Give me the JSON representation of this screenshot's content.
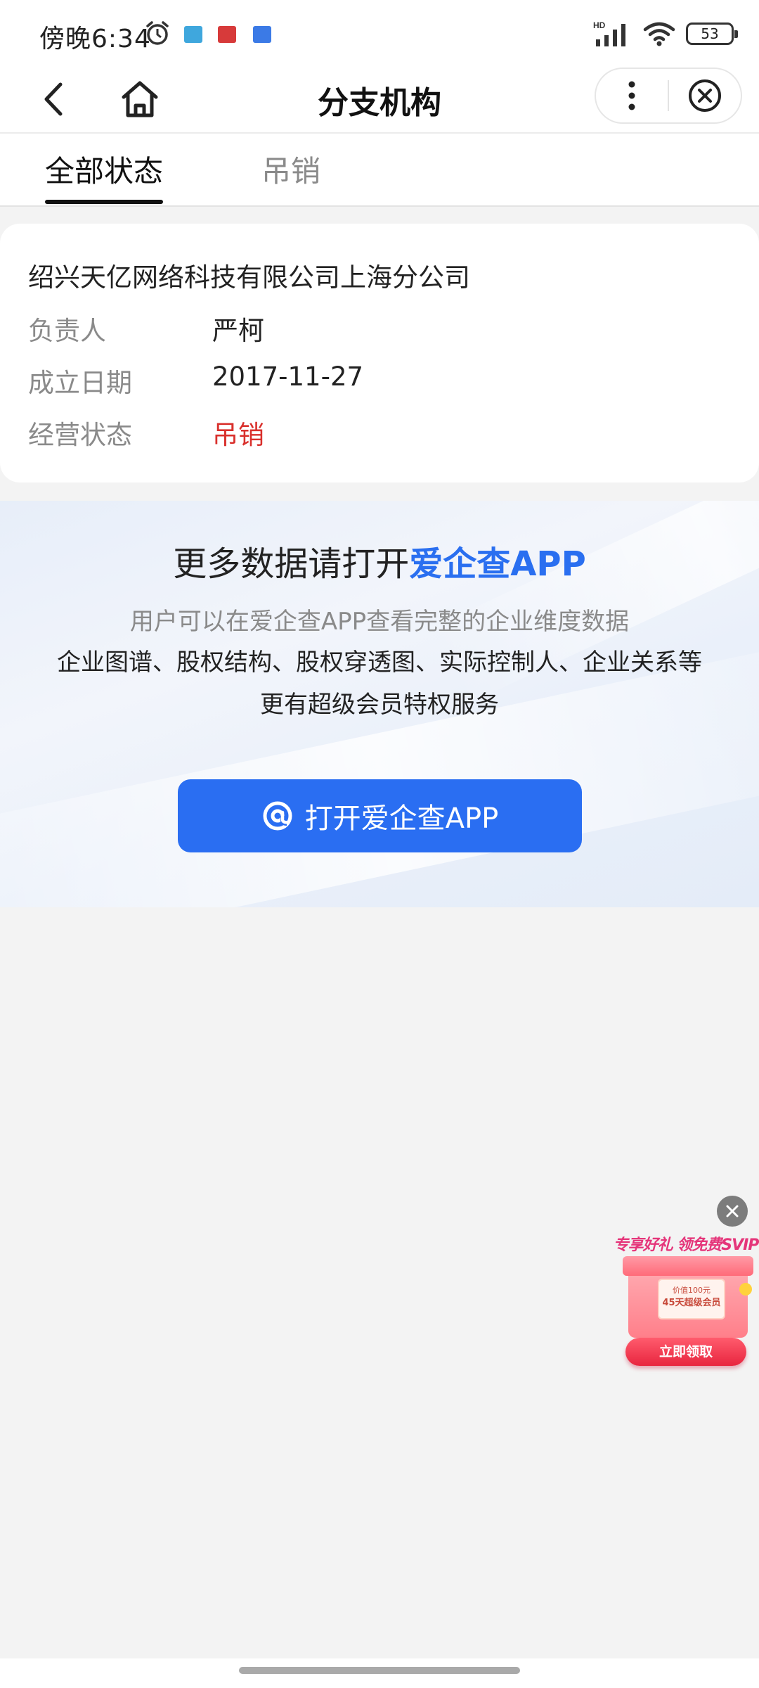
{
  "status_bar": {
    "time": "傍晚6:34",
    "battery": "53",
    "network": "HD"
  },
  "nav": {
    "title": "分支机构"
  },
  "tabs": [
    {
      "label": "全部状态",
      "active": true
    },
    {
      "label": "吊销",
      "active": false
    }
  ],
  "branch": {
    "company_name": "绍兴天亿网络科技有限公司上海分公司",
    "rows": [
      {
        "label": "负责人",
        "value": "严柯"
      },
      {
        "label": "成立日期",
        "value": "2017-11-27"
      },
      {
        "label": "经营状态",
        "value": "吊销"
      }
    ]
  },
  "promo": {
    "title_prefix": "更多数据请打开",
    "title_brand": "爱企查APP",
    "line1": "用户可以在爱企查APP查看完整的企业维度数据",
    "line2": "企业图谱、股权结构、股权穿透图、实际控制人、企业关系等",
    "line3": "更有超级会员特权服务",
    "button_label": "打开爱企查APP"
  },
  "float_ad": {
    "banner": "专享好礼 领免费SVIP",
    "card_price": "价值100元",
    "card_text": "45天超级会员",
    "tag": "SVIP",
    "button_label": "立即领取"
  },
  "colors": {
    "accent_blue": "#2a6ef2",
    "status_red": "#d9302c"
  }
}
